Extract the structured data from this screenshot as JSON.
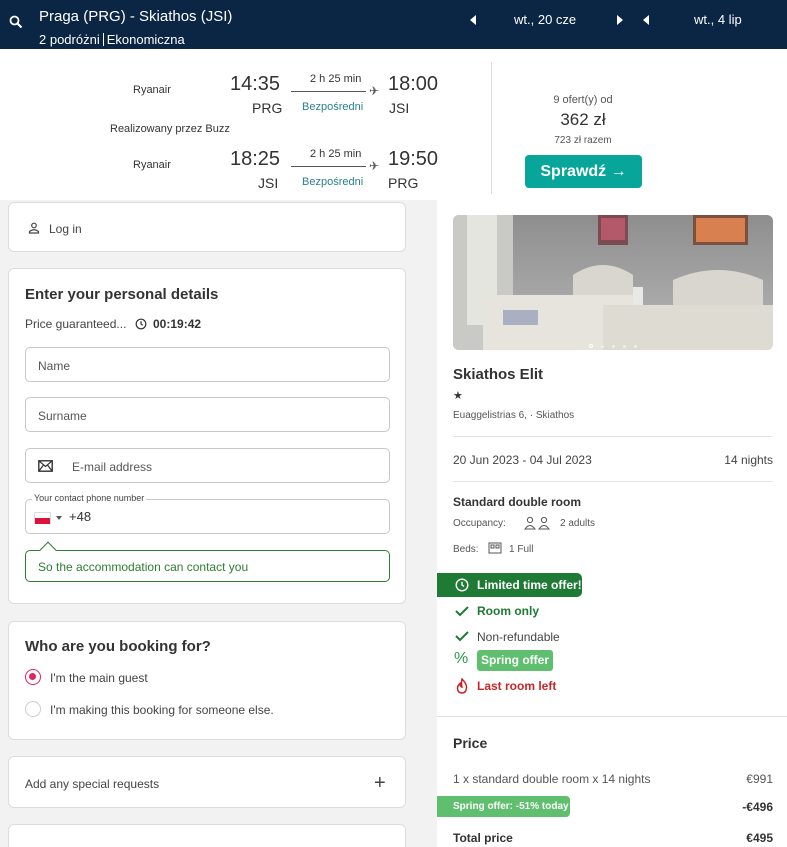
{
  "header": {
    "route": "Praga (PRG) - Skiathos (JSI)",
    "travellers": "2 podróżni",
    "cabin": "Ekonomiczna",
    "depart_date": "wt., 20 cze",
    "return_date": "wt., 4 lip"
  },
  "flights": {
    "outbound": {
      "airline": "Ryanair",
      "dep_time": "14:35",
      "dep_code": "PRG",
      "duration": "2 h 25 min",
      "stops": "Bezpośredni",
      "arr_time": "18:00",
      "arr_code": "JSI"
    },
    "operated_by": "Realizowany przez Buzz",
    "inbound": {
      "airline": "Ryanair",
      "dep_time": "18:25",
      "dep_code": "JSI",
      "duration": "2 h 25 min",
      "stops": "Bezpośredni",
      "arr_time": "19:50",
      "arr_code": "PRG"
    },
    "offers_count": "9 ofert(y) od",
    "price": "362 zł",
    "total": "723 zł razem",
    "check_label": "Sprawdź →"
  },
  "form": {
    "login_label": "Log in",
    "details_title": "Enter your personal details",
    "price_guaranteed": "Price guaranteed...",
    "timer": "00:19:42",
    "name_placeholder": "Name",
    "surname_placeholder": "Surname",
    "email_placeholder": "E-mail address",
    "phone_label": "Your contact phone number",
    "phone_code": "+48",
    "contact_note": "So the accommodation can contact you",
    "booking_title": "Who are you booking for?",
    "option_main": "I'm the main guest",
    "option_other": "I'm making this booking for someone else.",
    "special_requests": "Add any special requests",
    "plus": "+"
  },
  "hotel": {
    "name": "Skiathos Elit",
    "star": "★",
    "address": "Euaggelistrias 6, · Skiathos",
    "dates": "20 Jun 2023 - 04 Jul 2023",
    "nights": "14 nights",
    "room": "Standard double room",
    "occupancy_label": "Occupancy:",
    "occupancy_value": "2 adults",
    "beds_label": "Beds:",
    "beds_value": "1 Full",
    "limited_offer": "Limited time offer!",
    "room_only": "Room only",
    "non_refundable": "Non-refundable",
    "spring_offer": "Spring offer",
    "last_room": "Last room left",
    "pct_symbol": "%"
  },
  "price": {
    "title": "Price",
    "line": "1 x standard double room x 14 nights",
    "line_amount": "€991",
    "discount_label": "Spring offer: -51% today",
    "discount_amount": "-€496",
    "total_label": "Total price",
    "total_amount": "€495"
  },
  "colors": {
    "header_bg": "#0b2545",
    "accent_teal": "#07a59a",
    "green_dark": "#1e7a34",
    "green_light": "#5fbf6e",
    "red": "#c62828",
    "radio_pink": "#e0245e"
  }
}
